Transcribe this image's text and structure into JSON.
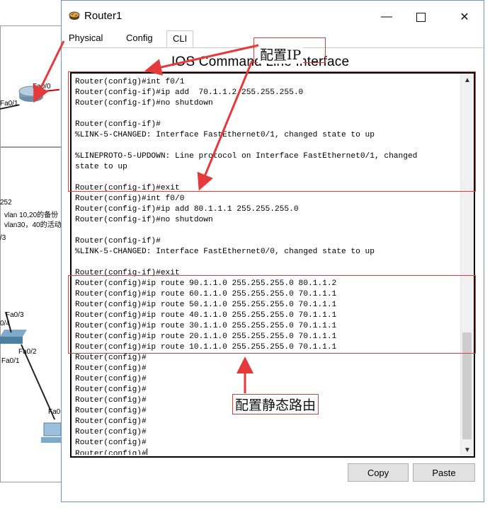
{
  "background": {
    "labels": [
      "Fa0/1",
      "Fa0/0",
      "252",
      "vlan 10,20的备份",
      "vlan30，40的活动",
      "/3",
      "Fa0/3",
      "0/4",
      "Fa0/2",
      "Fa0/1",
      "Fa0"
    ]
  },
  "window": {
    "title": "Router1",
    "icon": "router-icon",
    "controls": {
      "minimize": "—",
      "close": "✕"
    }
  },
  "tabs": [
    "Physical",
    "Config",
    "CLI"
  ],
  "active_tab": "CLI",
  "cli": {
    "heading": "IOS Command Line Interface",
    "lines": [
      "Router(config)#int f0/1",
      "Router(config-if)#ip add  70.1.1.2 255.255.255.0",
      "Router(config-if)#no shutdown",
      "",
      "Router(config-if)#",
      "%LINK-5-CHANGED: Interface FastEthernet0/1, changed state to up",
      "",
      "%LINEPROTO-5-UPDOWN: Line protocol on Interface FastEthernet0/1, changed",
      "state to up",
      "",
      "Router(config-if)#exit",
      "Router(config)#int f0/0",
      "Router(config-if)#ip add 80.1.1.1 255.255.255.0",
      "Router(config-if)#no shutdown",
      "",
      "Router(config-if)#",
      "%LINK-5-CHANGED: Interface FastEthernet0/0, changed state to up",
      "",
      "Router(config-if)#exit",
      "Router(config)#ip route 90.1.1.0 255.255.255.0 80.1.1.2",
      "Router(config)#ip route 60.1.1.0 255.255.255.0 70.1.1.1",
      "Router(config)#ip route 50.1.1.0 255.255.255.0 70.1.1.1",
      "Router(config)#ip route 40.1.1.0 255.255.255.0 70.1.1.1",
      "Router(config)#ip route 30.1.1.0 255.255.255.0 70.1.1.1",
      "Router(config)#ip route 20.1.1.0 255.255.255.0 70.1.1.1",
      "Router(config)#ip route 10.1.1.0 255.255.255.0 70.1.1.1",
      "Router(config)#",
      "Router(config)#",
      "Router(config)#",
      "Router(config)#",
      "Router(config)#",
      "Router(config)#",
      "Router(config)#",
      "Router(config)#",
      "Router(config)#",
      "Router(config)#"
    ]
  },
  "buttons": {
    "copy": "Copy",
    "paste": "Paste"
  },
  "annotations": {
    "config_ip": "配置IP",
    "static_route": "配置静态路由",
    "color": "#e43a3a"
  }
}
